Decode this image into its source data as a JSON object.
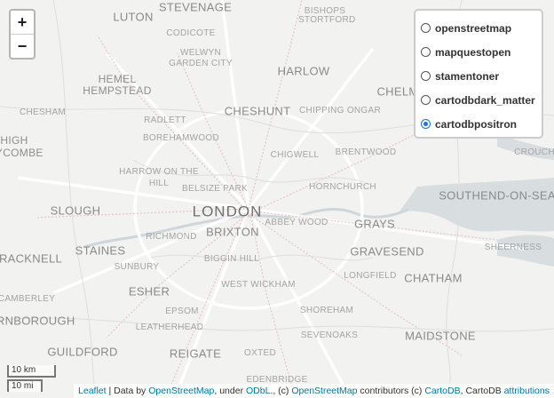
{
  "zoom": {
    "in_label": "+",
    "out_label": "−"
  },
  "layers": [
    {
      "label": "openstreetmap",
      "selected": false
    },
    {
      "label": "mapquestopen",
      "selected": false
    },
    {
      "label": "stamentoner",
      "selected": false
    },
    {
      "label": "cartodbdark_matter",
      "selected": false
    },
    {
      "label": "cartodbpositron",
      "selected": true
    }
  ],
  "scale": {
    "km": "10 km",
    "mi": "10 mi"
  },
  "attribution": {
    "leaflet": "Leaflet",
    "t1": " | Data by ",
    "osm1": "OpenStreetMap",
    "t2": ", under ",
    "odbl": "ODbL",
    "t3": "., (c) ",
    "osm2": "OpenStreetMap",
    "t4": " contributors (c) ",
    "carto": "CartoDB",
    "t5": ", CartoDB ",
    "attributions": "attributions"
  },
  "places": {
    "stevenage": "STEVENAGE",
    "luton": "LUTON",
    "codicote": "CODICOTE",
    "bishops_stortford": "BISHOPS STORTFORD",
    "welwyn": "WELWYN GARDEN CITY",
    "harlow": "HARLOW",
    "hemel": "HEMEL HEMPSTEAD",
    "chesham": "CHESHAM",
    "radlett": "RADLETT",
    "cheshunt": "CHESHUNT",
    "chipping_ongar": "CHIPPING ONGAR",
    "chelmsford": "CHELM",
    "high_wycombe": "HIGH WYCOMBE",
    "borehamwood": "BOREHAMWOOD",
    "chigwell": "CHIGWELL",
    "brentwood": "BRENTWOOD",
    "crouch": "CROUCH",
    "harrow": "HARROW ON THE HILL",
    "belsize": "BELSIZE PARK",
    "hornchurch": "HORNCHURCH",
    "southend": "SOUTHEND-ON-SEA",
    "slough": "SLOUGH",
    "london": "LONDON",
    "abbey_wood": "ABBEY WOOD",
    "grays": "GRAYS",
    "richmond": "RICHMOND",
    "brixton": "BRIXTON",
    "bracknell": "BRACKNELL",
    "staines": "STAINES",
    "gravesend": "GRAVESEND",
    "sheerness": "SHEERNESS",
    "sunbury": "SUNBURY",
    "biggin_hill": "BIGGIN HILL",
    "chatham": "CHATHAM",
    "esher": "ESHER",
    "west_wickham": "WEST WICKHAM",
    "longfield": "LONGFIELD",
    "camberley": "CAMBERLEY",
    "epsom": "EPSOM",
    "shoreham": "SHOREHAM",
    "farnborough": "FARNBOROUGH",
    "leatherhead": "LEATHERHEAD",
    "sevenoaks": "SEVENOAKS",
    "maidstone": "MAIDSTONE",
    "guildford": "GUILDFORD",
    "reigate": "REIGATE",
    "oxted": "OXTED",
    "edenbridge": "EDENBRIDGE"
  }
}
